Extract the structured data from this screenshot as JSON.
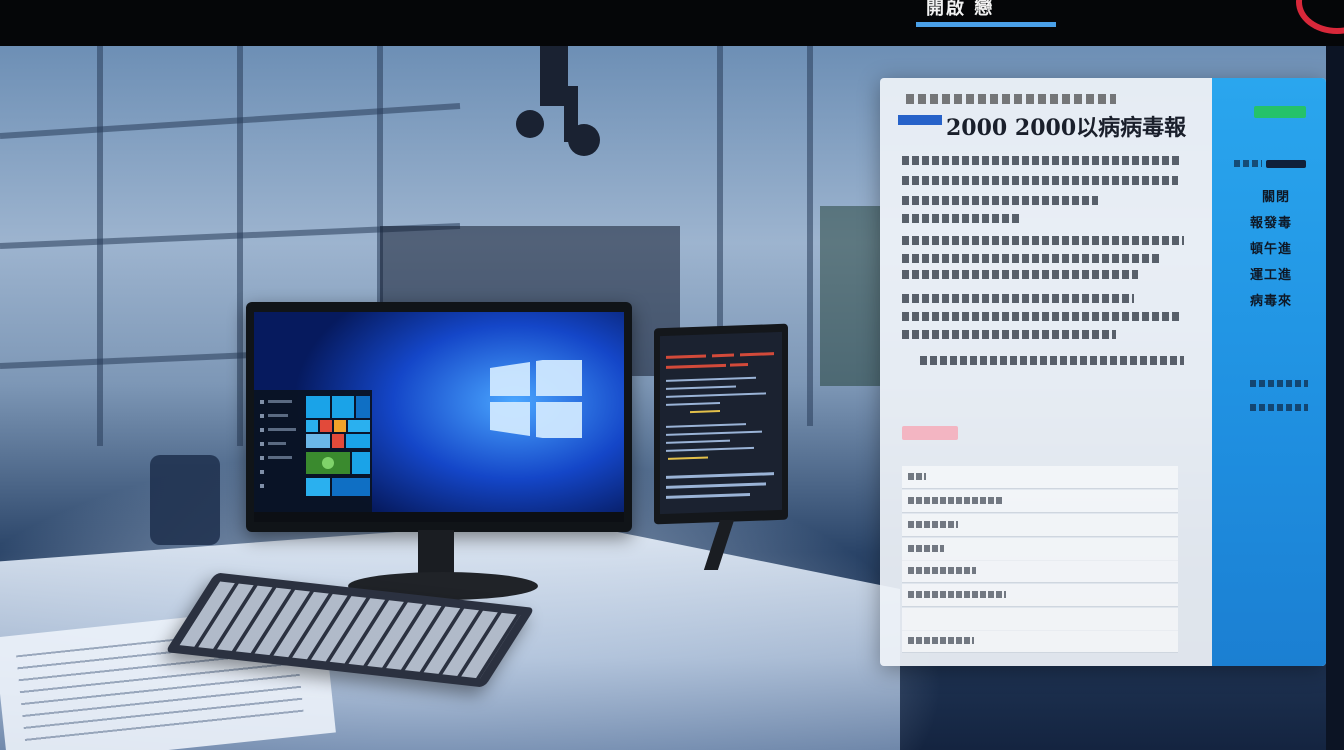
{
  "header": {
    "title": "開啟 戀"
  },
  "panel": {
    "title": "2000 2000以病病毒報",
    "side_labels": [
      "關閉",
      "報發毒",
      "頓午進",
      "運工進",
      "病毒來"
    ]
  },
  "colors": {
    "accent_blue": "#1f8fe0",
    "header_underline": "#4aa0e8",
    "header_swoosh": "#d8283a",
    "chip_green": "#25c26a",
    "chip_pink": "#f3b5c2"
  },
  "icons": {
    "windows_logo": "windows-logo-icon"
  }
}
